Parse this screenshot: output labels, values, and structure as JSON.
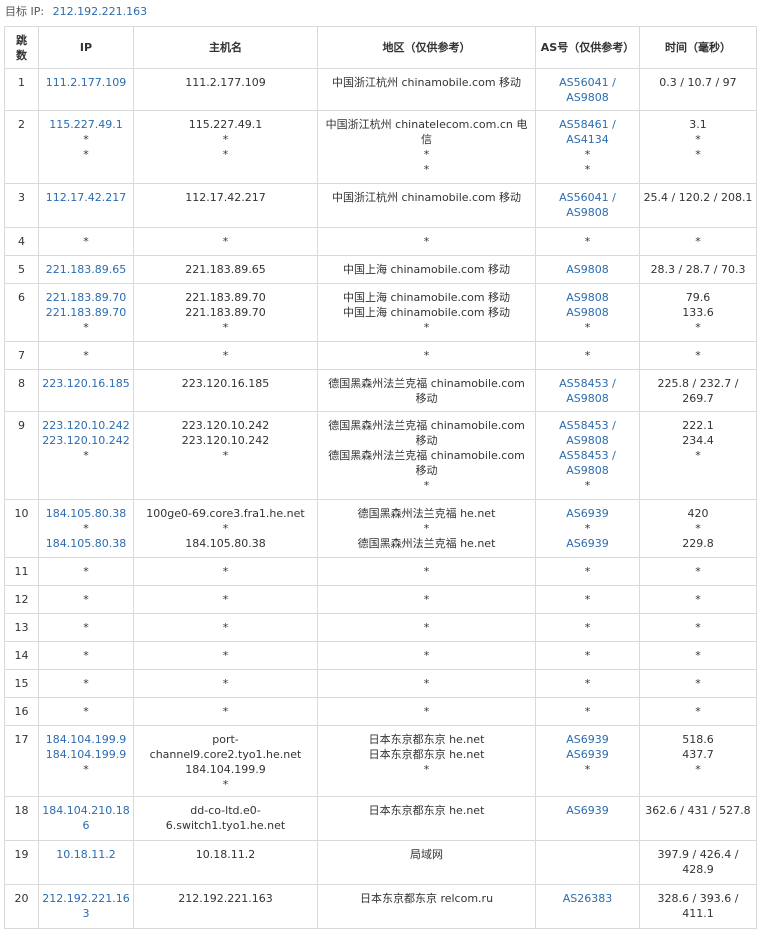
{
  "target": {
    "label": "目标 IP:",
    "ip": "212.192.221.163"
  },
  "columns": {
    "hop": [
      "跳",
      "数"
    ],
    "ip": "IP",
    "host": "主机名",
    "region": "地区（仅供参考）",
    "as": "AS号（仅供参考）",
    "time": "时间（毫秒）"
  },
  "rows": [
    {
      "hop": "1",
      "h": 42,
      "ip": [
        "111.2.177.109"
      ],
      "host": [
        "111.2.177.109"
      ],
      "region": [
        "中国浙江杭州 chinamobile.com 移动"
      ],
      "as": [
        "AS56041 /",
        "AS9808"
      ],
      "time": [
        "0.3 / 10.7 / 97"
      ]
    },
    {
      "hop": "2",
      "h": 73,
      "ip": [
        "115.227.49.1",
        "*",
        "*"
      ],
      "host": [
        "115.227.49.1",
        "*",
        "*"
      ],
      "region": [
        "中国浙江杭州 chinatelecom.com.cn 电信",
        "*",
        "*"
      ],
      "as": [
        "AS58461 /",
        "AS4134",
        "*",
        "*"
      ],
      "time": [
        "3.1",
        "*",
        "*"
      ]
    },
    {
      "hop": "3",
      "h": 44,
      "ip": [
        "112.17.42.217"
      ],
      "host": [
        "112.17.42.217"
      ],
      "region": [
        "中国浙江杭州 chinamobile.com 移动"
      ],
      "as": [
        "AS56041 /",
        "AS9808"
      ],
      "time": [
        "25.4 / 120.2 / 208.1"
      ]
    },
    {
      "hop": "4",
      "h": 28,
      "ip": [
        "*"
      ],
      "host": [
        "*"
      ],
      "region": [
        "*"
      ],
      "as": [
        "*"
      ],
      "time": [
        "*"
      ]
    },
    {
      "hop": "5",
      "h": 28,
      "ip": [
        "221.183.89.65"
      ],
      "host": [
        "221.183.89.65"
      ],
      "region": [
        "中国上海 chinamobile.com 移动"
      ],
      "as": [
        "AS9808"
      ],
      "time": [
        "28.3 / 28.7 / 70.3"
      ]
    },
    {
      "hop": "6",
      "h": 58,
      "ip": [
        "221.183.89.70",
        "221.183.89.70",
        "*"
      ],
      "host": [
        "221.183.89.70",
        "221.183.89.70",
        "*"
      ],
      "region": [
        "中国上海 chinamobile.com 移动",
        "中国上海 chinamobile.com 移动",
        "*"
      ],
      "as": [
        "AS9808",
        "AS9808",
        "*"
      ],
      "time": [
        "79.6",
        "133.6",
        "*"
      ]
    },
    {
      "hop": "7",
      "h": 28,
      "ip": [
        "*"
      ],
      "host": [
        "*"
      ],
      "region": [
        "*"
      ],
      "as": [
        "*"
      ],
      "time": [
        "*"
      ]
    },
    {
      "hop": "8",
      "h": 42,
      "ip": [
        "223.120.16.185"
      ],
      "host": [
        "223.120.16.185"
      ],
      "region": [
        "德国黑森州法兰克福 chinamobile.com 移动"
      ],
      "as": [
        "AS58453 /",
        "AS9808"
      ],
      "time": [
        "225.8 / 232.7 /",
        "269.7"
      ]
    },
    {
      "hop": "9",
      "h": 88,
      "ip": [
        "223.120.10.242",
        "223.120.10.242",
        "*"
      ],
      "host": [
        "223.120.10.242",
        "223.120.10.242",
        "*"
      ],
      "region": [
        "德国黑森州法兰克福 chinamobile.com 移动",
        "德国黑森州法兰克福 chinamobile.com 移动",
        "*"
      ],
      "as": [
        "AS58453 /",
        "AS9808",
        "AS58453 /",
        "AS9808",
        "*"
      ],
      "time": [
        "222.1",
        "234.4",
        "*"
      ]
    },
    {
      "hop": "10",
      "h": 58,
      "ip": [
        "184.105.80.38",
        "*",
        "184.105.80.38"
      ],
      "host": [
        "100ge0-69.core3.fra1.he.net",
        "*",
        "184.105.80.38"
      ],
      "region": [
        "德国黑森州法兰克福 he.net",
        "*",
        "德国黑森州法兰克福 he.net"
      ],
      "as": [
        "AS6939",
        "*",
        "AS6939"
      ],
      "time": [
        "420",
        "*",
        "229.8"
      ]
    },
    {
      "hop": "11",
      "h": 28,
      "ip": [
        "*"
      ],
      "host": [
        "*"
      ],
      "region": [
        "*"
      ],
      "as": [
        "*"
      ],
      "time": [
        "*"
      ]
    },
    {
      "hop": "12",
      "h": 28,
      "ip": [
        "*"
      ],
      "host": [
        "*"
      ],
      "region": [
        "*"
      ],
      "as": [
        "*"
      ],
      "time": [
        "*"
      ]
    },
    {
      "hop": "13",
      "h": 28,
      "ip": [
        "*"
      ],
      "host": [
        "*"
      ],
      "region": [
        "*"
      ],
      "as": [
        "*"
      ],
      "time": [
        "*"
      ]
    },
    {
      "hop": "14",
      "h": 28,
      "ip": [
        "*"
      ],
      "host": [
        "*"
      ],
      "region": [
        "*"
      ],
      "as": [
        "*"
      ],
      "time": [
        "*"
      ]
    },
    {
      "hop": "15",
      "h": 28,
      "ip": [
        "*"
      ],
      "host": [
        "*"
      ],
      "region": [
        "*"
      ],
      "as": [
        "*"
      ],
      "time": [
        "*"
      ]
    },
    {
      "hop": "16",
      "h": 28,
      "ip": [
        "*"
      ],
      "host": [
        "*"
      ],
      "region": [
        "*"
      ],
      "as": [
        "*"
      ],
      "time": [
        "*"
      ]
    },
    {
      "hop": "17",
      "h": 58,
      "ip": [
        "184.104.199.9",
        "184.104.199.9",
        "*"
      ],
      "host": [
        "port-channel9.core2.tyo1.he.net",
        "184.104.199.9",
        "*"
      ],
      "region": [
        "日本东京都东京 he.net",
        "日本东京都东京 he.net",
        "*"
      ],
      "as": [
        "AS6939",
        "AS6939",
        "*"
      ],
      "time": [
        "518.6",
        "437.7",
        "*"
      ]
    },
    {
      "hop": "18",
      "h": 44,
      "ip": [
        "184.104.210.186"
      ],
      "host": [
        "dd-co-ltd.e0-6.switch1.tyo1.he.net"
      ],
      "region": [
        "日本东京都东京 he.net"
      ],
      "as": [
        "AS6939"
      ],
      "time": [
        "362.6 / 431 / 527.8"
      ]
    },
    {
      "hop": "19",
      "h": 44,
      "ip": [
        "10.18.11.2"
      ],
      "host": [
        "10.18.11.2"
      ],
      "region": [
        "局域网"
      ],
      "as": [],
      "time": [
        "397.9 / 426.4 /",
        "428.9"
      ]
    },
    {
      "hop": "20",
      "h": 44,
      "ip": [
        "212.192.221.163"
      ],
      "host": [
        "212.192.221.163"
      ],
      "region": [
        "日本东京都东京 relcom.ru"
      ],
      "as": [
        "AS26383"
      ],
      "time": [
        "328.6 / 393.6 /",
        "411.1"
      ]
    }
  ],
  "colors": {
    "link": "#2b6cb0",
    "border": "#d9d9d9",
    "text": "#333333"
  }
}
